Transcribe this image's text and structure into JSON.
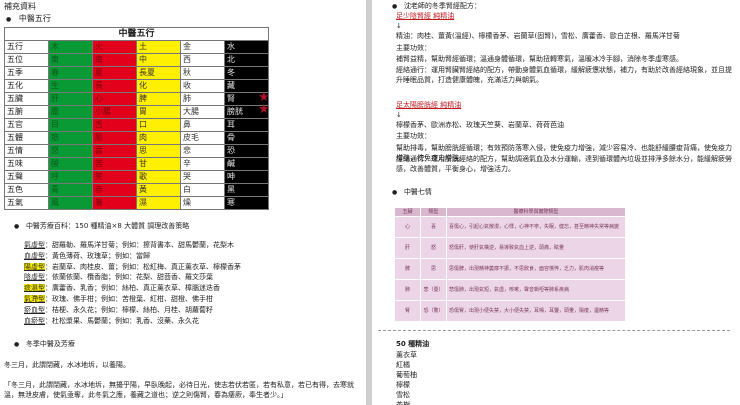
{
  "left": {
    "section_label": "補充資料",
    "wuxing_heading": "中醫五行",
    "wuxing_table": {
      "title": "中醫五行",
      "rows": [
        [
          "五行",
          "木",
          "火",
          "土",
          "金",
          "水"
        ],
        [
          "五位",
          "東",
          "南",
          "中",
          "西",
          "北"
        ],
        [
          "五季",
          "春",
          "夏",
          "長夏",
          "秋",
          "冬"
        ],
        [
          "五化",
          "生",
          "長",
          "化",
          "收",
          "藏"
        ],
        [
          "五臟",
          "肝",
          "心",
          "脾",
          "肺",
          "腎"
        ],
        [
          "五腑",
          "膽",
          "小腸",
          "胃",
          "大腸",
          "膀胱"
        ],
        [
          "五官",
          "目",
          "舌",
          "口",
          "鼻",
          "耳"
        ],
        [
          "五體",
          "筋",
          "脈",
          "肉",
          "皮毛",
          "骨"
        ],
        [
          "五情",
          "怒",
          "喜",
          "思",
          "悲",
          "恐"
        ],
        [
          "五味",
          "酸",
          "苦",
          "甘",
          "辛",
          "鹹"
        ],
        [
          "五聲",
          "呼",
          "笑",
          "歌",
          "哭",
          "呻"
        ],
        [
          "五色",
          "青",
          "赤",
          "黃",
          "白",
          "黑"
        ],
        [
          "五氣",
          "風",
          "暑",
          "濕",
          "燥",
          "寒"
        ]
      ]
    },
    "aroma_heading": "中醫芳療百科：150 種精油×8 大體質 調理改善策略",
    "constitutions": [
      {
        "name": "氣虛型",
        "text": "：甜羅勒、羅馬洋甘菊；例如：擦背書本、甜馬鬱蘭，花梨木"
      },
      {
        "name": "血虛型",
        "text": "：黃色薄荷、玫瑰草；例如：當歸"
      },
      {
        "name": "陽虛型",
        "text": "：岩蘭草、肉桂皮、薑；例如：松紅梅、真正薰衣草、檸檬香茅"
      },
      {
        "name": "陰虛型",
        "text": "：依蘭依蘭、欖香脂；例如：花梨、甜茴香、羅文莎葉"
      },
      {
        "name": "痰濕型",
        "text": "：廣藿香、乳香；例如：絲柏、真正薰衣草、樟腦迷迭香"
      },
      {
        "name": "氣滯型",
        "text": "：玫瑰、佛手柑；例如：苦橙葉、紅柑、甜橙、佛手柑"
      },
      {
        "name": "瘀血型",
        "text": "：桔梗、永久花；例如：檸檬、絲柏、月桂、胡蘿蔔籽"
      },
      {
        "name": "血瘀型",
        "text": "：杜松漿果、馬鬱蘭；例如：乳香、沒藥、永久花"
      }
    ],
    "winter_heading": "冬季中醫及芳療",
    "winter_line": "冬三月，此謂閉藏，水冰地坼，以養陽。",
    "quote": "「冬三月，此謂閉藏，水冰地坼，無擾乎陽，早臥晚起，必待日光，使志若伏若匿，若有私意，若已有得，去寒就溫，無泄皮膚，使氣亟奪，此冬氣之應，養藏之道也；逆之則傷腎，春為痿厥，奉生者少。」"
  },
  "right": {
    "top_heading": "沈老師的冬季腎經配方：",
    "recipe1": {
      "title": "足少陰腎經 純精油",
      "bullet": "↓",
      "ingredients_label": "精油：",
      "ingredients": "肉桂、薑黃(溫經)、檸檬香茅、岩蘭草(固腎)，雪松、廣藿香、歐白芷根、羅馬洋甘菊",
      "effect_label": "主要功效：",
      "effects": [
        "補腎益精，幫助腎經循環；溫通身體循環，幫助扭轉寒氣，溫暖冰冷手腳，消除冬季虛寒感。",
        "經絡通行：運用腎臟腎經絡的配方，帶動身體氣血循環，緩解疲憊狀態，補力，有助於改善經絡現象，並且提升睡眠品質，打造健康體魄，充滿活力與朝氣。"
      ]
    },
    "recipe2": {
      "title": "足太陽膀胱經 純精油",
      "bullet": "↓",
      "ingredients": "檸檬香茅、歐洲赤松、玫瑰天竺葵、岩蘭草、荷荷芭油",
      "effect_label": "主要功效：",
      "effects": [
        "幫助排毒，幫助膀胱經循環；有效預防落寒入侵，使免疫力增強，減少容易冷、也能舒緩腰痠背痛，使免疫力增強，使免疫力增強。",
        "經絡通行：運用膀胱經絡的配方，幫助調適氣血及水分運輸，達到循環體內垃圾並排淨多餘水分，能緩解疲勞感，改善體質，平衡身心，增強活力。"
      ]
    },
    "qiqing_heading": "中醫七情",
    "qiqing_table": {
      "headers": [
        "五臟",
        "類型",
        "醫療科學與實際類型"
      ],
      "rows": [
        {
          "organ": "心",
          "emotion": "喜",
          "desc": "喜傷心，引起心氣散漫，心悸，心神不寧，失眠，健忘，甚至精神失常等病變"
        },
        {
          "organ": "肝",
          "emotion": "怒",
          "desc": "怒傷肝，使肝氣橫逆，易導致氣血上逆，頭痛，眩暈"
        },
        {
          "organ": "脾",
          "emotion": "思",
          "desc": "思傷脾，出現精神萎靡不振，不思飲食，面容憔悴，乏力，肌肉消瘦等"
        },
        {
          "organ": "肺",
          "emotion": "悲（憂）",
          "desc": "悲傷肺，出現氣短，氣虛，咳嗽，聲音嘶啞等肺系疾病"
        },
        {
          "organ": "腎",
          "emotion": "恐（驚）",
          "desc": "恐傷腎，出現小便失禁，大小便失禁，耳鳴，耳聾，頭暈，陽痿，遺精等"
        }
      ]
    },
    "list_heading": "50 種精油",
    "list_items": [
      "薰衣草",
      "紅橘",
      "葡萄柚",
      "檸檬",
      "雪松",
      "茶樹"
    ]
  },
  "colors": {
    "wood": "#0a9a35",
    "fire": "#e2001a",
    "earth": "#ffef00",
    "metal": "#ffffff",
    "water": "#000000",
    "recipe_title": "#c0191f",
    "qiqing_cell": "#ecd5e6"
  },
  "icons": [
    "star-icon",
    "bullet-icon"
  ]
}
